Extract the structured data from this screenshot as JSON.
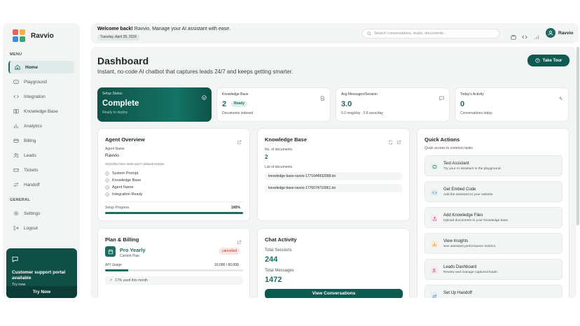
{
  "brand": {
    "name": "Ravvio"
  },
  "sidebar": {
    "menu_label": "MENU",
    "general_label": "GENERAL",
    "items": [
      {
        "label": "Home",
        "icon": "home-icon"
      },
      {
        "label": "Playground",
        "icon": "playground-icon"
      },
      {
        "label": "Integration",
        "icon": "code-icon"
      },
      {
        "label": "Knowledge Base",
        "icon": "book-icon"
      },
      {
        "label": "Analytics",
        "icon": "bar-chart-icon"
      },
      {
        "label": "Billing",
        "icon": "credit-card-icon"
      },
      {
        "label": "Leads",
        "icon": "users-icon"
      },
      {
        "label": "Tickets",
        "icon": "ticket-icon"
      },
      {
        "label": "Handoff",
        "icon": "swap-icon"
      }
    ],
    "general_items": [
      {
        "label": "Settings",
        "icon": "gear-icon"
      },
      {
        "label": "Logout",
        "icon": "logout-icon"
      }
    ],
    "promo": {
      "title": "Customer support portal available",
      "subtitle": "Try now",
      "button": "Try Now"
    }
  },
  "topbar": {
    "welcome_bold": "Welcome back!",
    "welcome_rest": " Ravvio, Manage your AI assistant with ease.",
    "date": "Tuesday, April 28, 2026",
    "search_placeholder": "Search conversations, leads, documents...",
    "user_name": "Ravvio"
  },
  "main": {
    "title": "Dashboard",
    "subtitle": "Instant, no-code AI chatbot that captures leads 24/7 and keeps getting smarter.",
    "tour_button": "Take Tour",
    "stats": {
      "setup": {
        "label": "Setup Status",
        "value": "Complete",
        "sub": "Ready to deploy"
      },
      "kb": {
        "label": "Knowledge Base",
        "value": "2",
        "badge": "Ready",
        "sub": "Documents indexed"
      },
      "avg": {
        "label": "Avg Messages/Session",
        "value": "3.0",
        "sub": "5.0 msg/day · 0.8 sess/day"
      },
      "today": {
        "label": "Today's Activity",
        "value": "0",
        "sub": "Conversations today"
      }
    },
    "agent": {
      "title": "Agent Overview",
      "name_label": "Agent Name",
      "name": "Ravvio",
      "id": "0631df63-f50e-480b-a927-cbf8eeb78d6be",
      "checks": [
        "System Prompt",
        "Knowledge Base",
        "Agent Name",
        "Integration Ready"
      ],
      "progress_label": "Setup Progress",
      "progress_value": "100%",
      "progress_fraction": 1.0
    },
    "knowledge": {
      "title": "Knowledge Base",
      "docs_label": "No. of documents",
      "docs_count": "2",
      "list_label": "List of documents",
      "documents": [
        "knowledge-base-ravvio-1771644932998.txt",
        "knowledge-base-ravvio-1776074710961.txt"
      ]
    },
    "quick_actions": {
      "title": "Quick Actions",
      "subtitle": "Quick access to common tasks",
      "items": [
        {
          "title": "Test Assistant",
          "sub": "Try your AI assistant in the playground.",
          "icon": "chat-icon",
          "color": "#e3f0ee"
        },
        {
          "title": "Get Embed Code",
          "sub": "Add the assistant to your website.",
          "icon": "code-icon",
          "color": "#e3eef6"
        },
        {
          "title": "Add Knowledge Files",
          "sub": "Upload documents to your knowledge base.",
          "icon": "upload-icon",
          "color": "#f6e6ef"
        },
        {
          "title": "View Insights",
          "sub": "See assistant performance metrics.",
          "icon": "bar-chart-icon",
          "color": "#faecd9"
        },
        {
          "title": "Leads Dashboard",
          "sub": "Review and manage captured leads.",
          "icon": "users-icon",
          "color": "#f6e6ef"
        },
        {
          "title": "Set Up Handoff",
          "sub": "",
          "icon": "swap-icon",
          "color": "#e3eef6"
        }
      ]
    },
    "plan": {
      "title": "Plan & Billing",
      "name": "Pro Yearly",
      "sub": "Current Plan",
      "badge": "cancelled",
      "usage_label": "API Usage",
      "usage_value": "10,000 / 60,000",
      "usage_fraction": 0.17,
      "usage_note": "17% used this month"
    },
    "chat": {
      "title": "Chat Activity",
      "sessions_label": "Total Sessions",
      "sessions": "244",
      "messages_label": "Total Messages",
      "messages": "1472",
      "button": "View Conversations"
    }
  },
  "colors": {
    "accent": "#1e6b60",
    "dark_accent": "#0f5a50",
    "danger": "#c0392b"
  }
}
